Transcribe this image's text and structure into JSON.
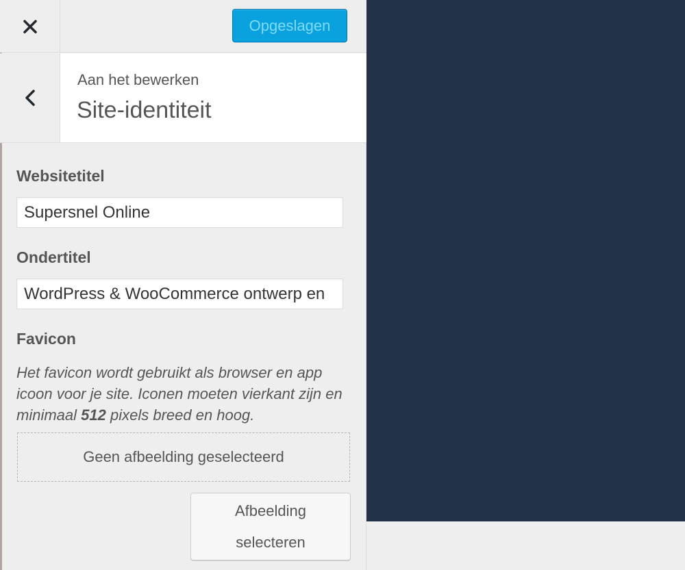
{
  "header": {
    "close_icon": "close-icon",
    "save_label": "Opgeslagen"
  },
  "section": {
    "back_icon": "chevron-left-icon",
    "editing_label": "Aan het bewerken",
    "title": "Site-identiteit"
  },
  "fields": {
    "site_title_label": "Websitetitel",
    "site_title_value": "Supersnel Online",
    "tagline_label": "Ondertitel",
    "tagline_value": "WordPress & WooCommerce ontwerp en",
    "favicon_label": "Favicon"
  },
  "favicon": {
    "description_part1": "Het favicon wordt gebruikt als browser en app icoon voor je site. Iconen moeten vierkant zijn en minimaal ",
    "description_bold": "512",
    "description_part2": " pixels breed en hoog.",
    "no_image_text": "Geen afbeelding geselecteerd",
    "select_line1": "Afbeelding",
    "select_line2": "selecteren"
  },
  "colors": {
    "primary_button": "#0aa1df",
    "primary_button_text": "#7fdcff",
    "preview_background": "#223249",
    "panel_background": "#eeeeee"
  }
}
